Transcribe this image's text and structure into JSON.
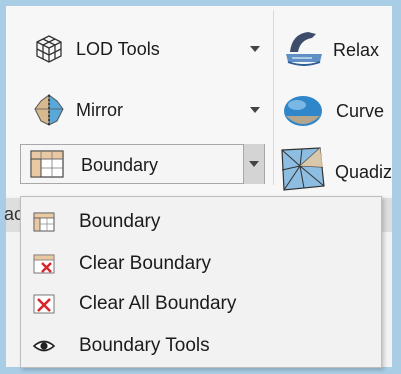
{
  "ribbon": {
    "left_buttons": [
      {
        "label": "LOD Tools",
        "icon": "lod-tools-icon"
      },
      {
        "label": "Mirror",
        "icon": "mirror-icon"
      },
      {
        "label": "Boundary",
        "icon": "boundary-grid-icon"
      }
    ],
    "right_buttons": [
      {
        "label": "Relax",
        "icon": "relax-iron-icon"
      },
      {
        "label": "Curve",
        "icon": "curve-ellipse-icon"
      },
      {
        "label": "Quadiz",
        "icon": "quadify-icon"
      }
    ],
    "obscured_text": "ac"
  },
  "menu": {
    "items": [
      {
        "label": "Boundary",
        "icon": "boundary-grid-icon"
      },
      {
        "label": "Clear Boundary",
        "icon": "clear-boundary-icon"
      },
      {
        "label": "Clear All Boundary",
        "icon": "clear-all-boundary-icon"
      },
      {
        "label": "Boundary Tools",
        "icon": "eye-icon"
      }
    ]
  },
  "colors": {
    "window_border": "#a9cde5",
    "ribbon_bg": "#f7f7f7",
    "menu_bg": "#f2f2f2",
    "split_button_bg": "#d4d4d4",
    "red_x": "#d9252a"
  }
}
